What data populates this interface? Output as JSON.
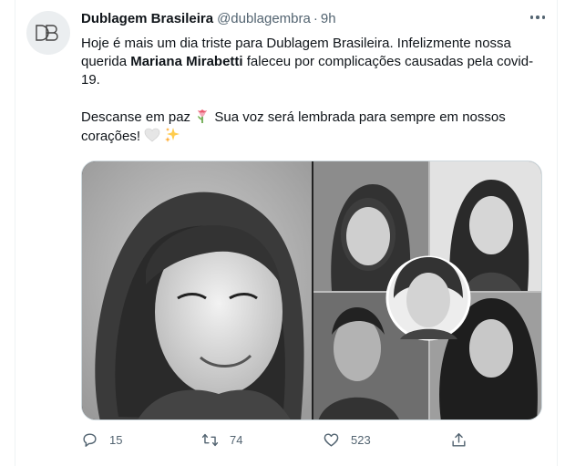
{
  "tweet": {
    "author_name": "Dublagem Brasileira",
    "handle": "@dublagembra",
    "separator": "·",
    "time": "9h",
    "text_line_1a": "Hoje é mais um dia triste para Dublagem Brasileira. Infelizmente nossa querida ",
    "text_bold": "Mariana Mirabetti",
    "text_line_1b": " faleceu por complicações causadas pela covid-19.",
    "text_line_2a": "Descanse em paz ",
    "text_line_2b": " Sua voz será lembrada para sempre em nossos corações! ",
    "avatar_logo": "DB"
  },
  "media": {
    "left_image": "black-and-white portrait of smiling woman with curly hair",
    "right_image": "collage of five black-and-white portraits of women"
  },
  "actions": {
    "reply_count": "15",
    "retweet_count": "74",
    "like_count": "523"
  },
  "icons": {
    "reply": "speech-bubble-icon",
    "retweet": "retweet-arrows-icon",
    "like": "heart-icon",
    "share": "share-upload-icon",
    "more": "more-dots-icon",
    "flower": "tulip-emoji",
    "white_heart": "white-heart-emoji",
    "sparkles": "sparkles-emoji"
  },
  "colors": {
    "text_primary": "#0f1419",
    "text_secondary": "#536471",
    "border": "#cfd9de",
    "avatar_bg": "#ebeef0"
  }
}
